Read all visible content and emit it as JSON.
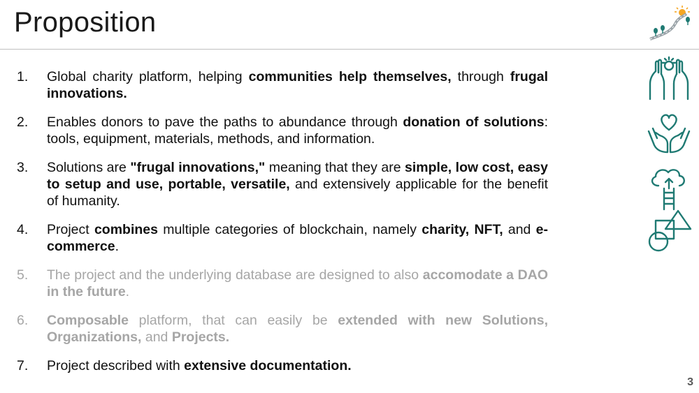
{
  "slide": {
    "title": "Proposition",
    "page_number": "3"
  },
  "items": [
    {
      "num": "1.",
      "faded": false,
      "parts": [
        {
          "t": "Global charity platform, helping "
        },
        {
          "t": "communities help themselves,",
          "b": true
        },
        {
          "t": " through "
        },
        {
          "t": "frugal innovations.",
          "b": true
        }
      ]
    },
    {
      "num": "2.",
      "faded": false,
      "parts": [
        {
          "t": "Enables donors to pave the paths to abundance through "
        },
        {
          "t": "donation of solutions",
          "b": true
        },
        {
          "t": ": tools, equipment, materials, methods, and information."
        }
      ]
    },
    {
      "num": "3.",
      "faded": false,
      "parts": [
        {
          "t": "Solutions are "
        },
        {
          "t": "\"frugal innovations,\"",
          "b": true
        },
        {
          "t": " meaning that they are "
        },
        {
          "t": "simple, low cost, easy to setup and use, portable, versatile,",
          "b": true
        },
        {
          "t": " and extensively applicable for the benefit of humanity."
        }
      ]
    },
    {
      "num": "4.",
      "faded": false,
      "parts": [
        {
          "t": "Project "
        },
        {
          "t": "combines",
          "b": true
        },
        {
          "t": " multiple categories of blockchain, namely "
        },
        {
          "t": "charity, NFT,",
          "b": true
        },
        {
          "t": " and "
        },
        {
          "t": "e-commerce",
          "b": true
        },
        {
          "t": "."
        }
      ]
    },
    {
      "num": "5.",
      "faded": true,
      "parts": [
        {
          "t": "The project and the underlying database are designed to also "
        },
        {
          "t": "accomodate a DAO in the future",
          "b": true
        },
        {
          "t": "."
        }
      ]
    },
    {
      "num": "6.",
      "faded": true,
      "parts": [
        {
          "t": "Composable",
          "b": true
        },
        {
          "t": " platform, that can easily be "
        },
        {
          "t": "extended with new Solutions, Organizations,",
          "b": true
        },
        {
          "t": " and "
        },
        {
          "t": "Projects.",
          "b": true
        }
      ]
    },
    {
      "num": "7.",
      "faded": false,
      "parts": [
        {
          "t": "Project described with "
        },
        {
          "t": "extensive documentation.",
          "b": true
        }
      ]
    }
  ],
  "icons": [
    "raised-hands-icon",
    "heart-in-hands-icon",
    "cloud-upload-ladder-icon",
    "shapes-icon",
    "road-logo-icon"
  ],
  "colors": {
    "accent": "#1f7a73",
    "faded_text": "#a6a6a6",
    "logo_sun": "#f5a623"
  }
}
